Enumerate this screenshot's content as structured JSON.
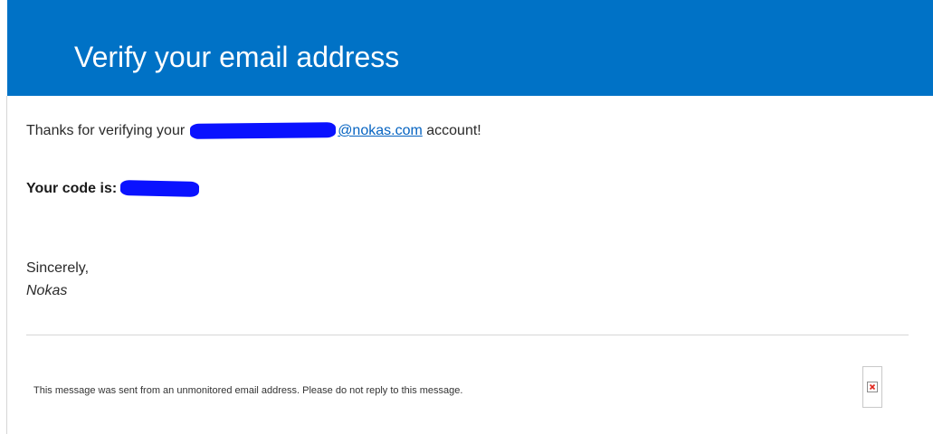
{
  "header": {
    "title": "Verify your email address",
    "background_color": "#0072c6"
  },
  "message": {
    "thanks_prefix": "Thanks for verifying your",
    "email_domain": "@nokas.com",
    "thanks_suffix": "account!",
    "code_label": "Your code is:",
    "closing": "Sincerely,",
    "signature": "Nokas",
    "redaction_color": "#0a12ff"
  },
  "footer": {
    "note": "This message was sent from an unmonitored email address. Please do not reply to this message.",
    "image_icon": "broken-image-icon"
  }
}
